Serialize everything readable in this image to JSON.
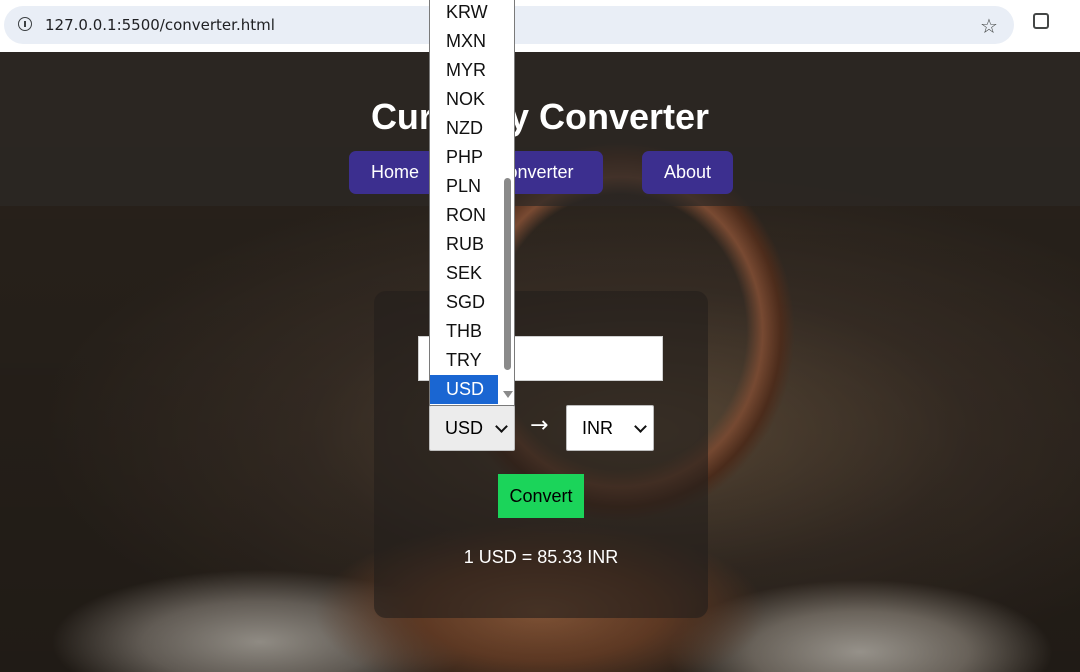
{
  "browser": {
    "url": "127.0.0.1:5500/converter.html"
  },
  "site": {
    "title": "Currency Converter",
    "nav": {
      "home": "Home",
      "converter": "Converter",
      "about": "About"
    }
  },
  "converter": {
    "amount_value": "",
    "from_currency": "USD",
    "to_currency": "INR",
    "arrow": "→",
    "convert_label": "Convert",
    "result": "1 USD = 85.33 INR"
  },
  "dropdown": {
    "items": [
      "KRW",
      "MXN",
      "MYR",
      "NOK",
      "NZD",
      "PHP",
      "PLN",
      "RON",
      "RUB",
      "SEK",
      "SGD",
      "THB",
      "TRY",
      "USD"
    ],
    "selected": "USD"
  },
  "colors": {
    "nav_button": "#3c2f8f",
    "convert_button": "#1bd45a",
    "selected_option": "#1a66d2"
  }
}
